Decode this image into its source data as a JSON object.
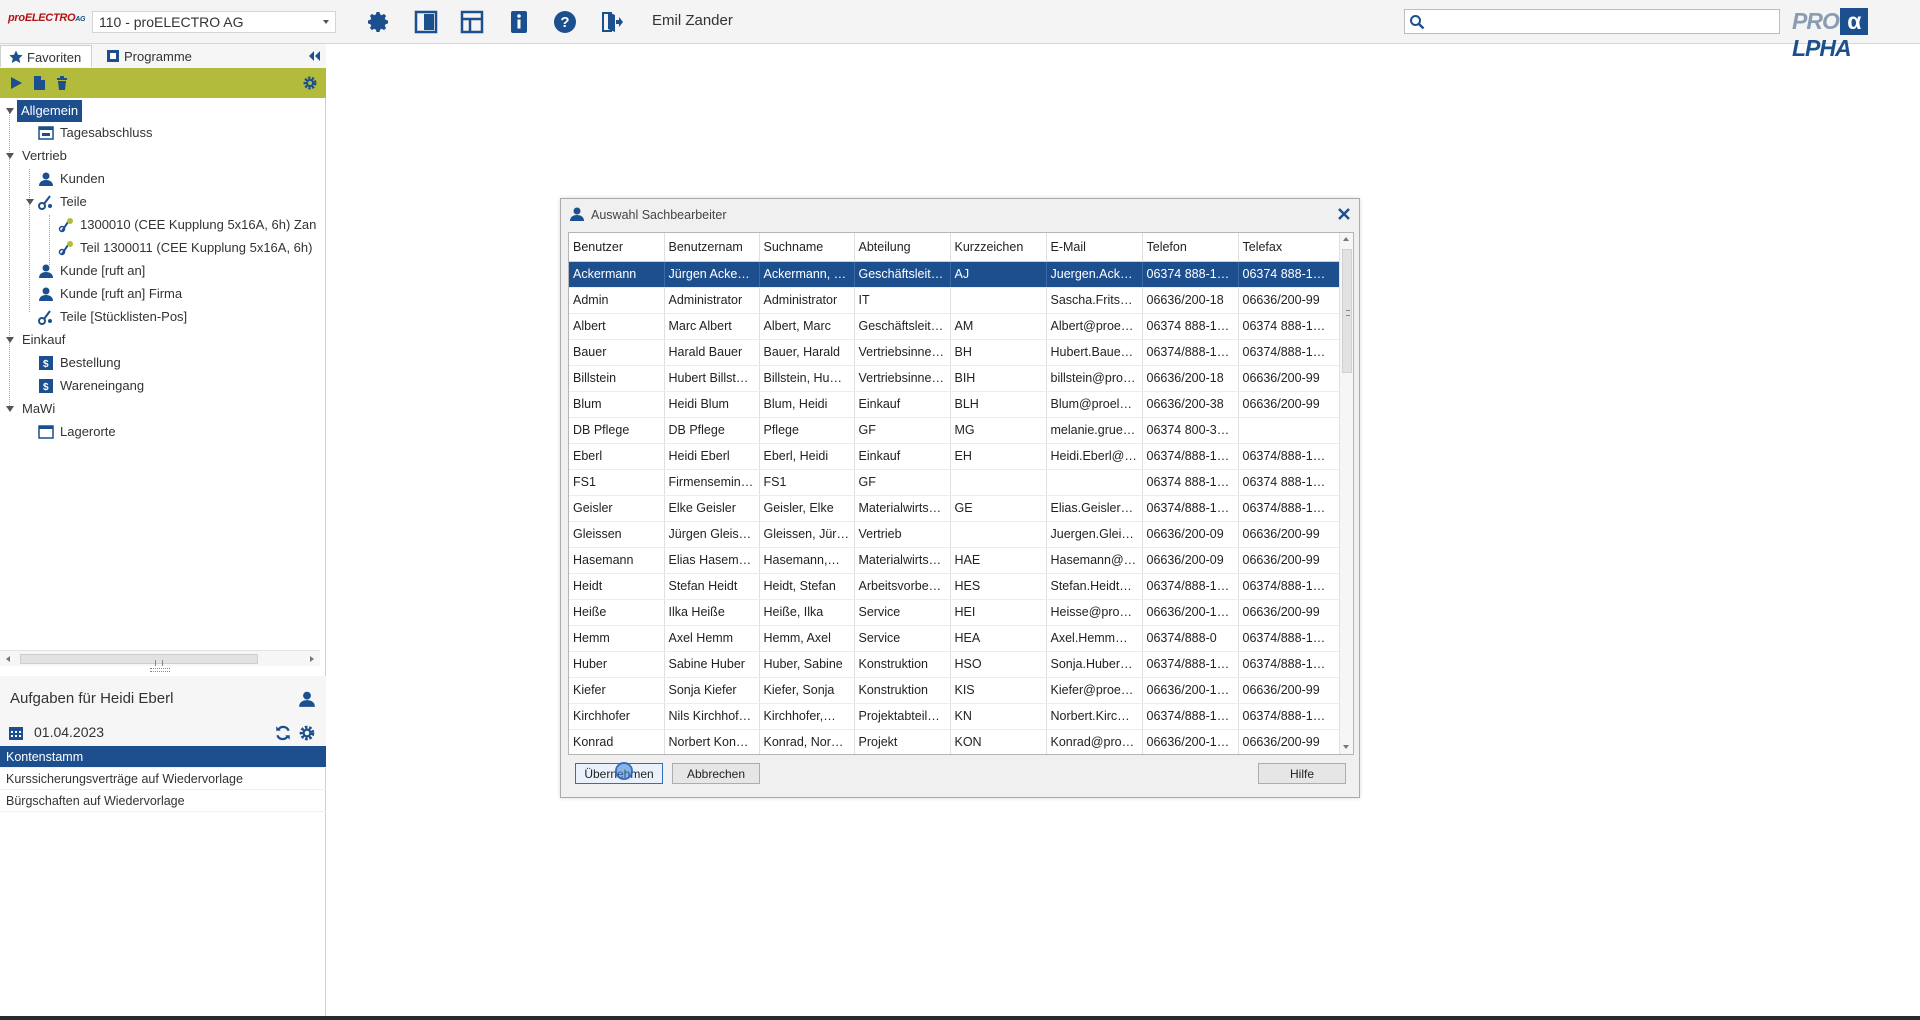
{
  "header": {
    "brand": "proELECTRO",
    "brand_suffix": "AG",
    "client": "110 - proELECTRO AG",
    "user": "Emil Zander",
    "search_value": "",
    "logo_pro": "PRO",
    "logo_alpha": "α",
    "logo_lpha": "LPHA",
    "colors": {
      "accent": "#1c4f8d",
      "toolbar_green": "#b3bb3c"
    }
  },
  "sidebar": {
    "tabs": [
      {
        "label": "Favoriten",
        "icon": "star-icon",
        "active": true
      },
      {
        "label": "Programme",
        "icon": "programs-icon",
        "active": false
      }
    ],
    "tree": {
      "allgemein": "Allgemein",
      "tagesabschluss": "Tagesabschluss",
      "vertrieb": "Vertrieb",
      "kunden": "Kunden",
      "teile": "Teile",
      "teil1": "1300010 (CEE Kupplung 5x16A, 6h) Zan",
      "teil2": "Teil 1300011 (CEE Kupplung 5x16A, 6h)",
      "kunde_ruft": "Kunde [ruft an]",
      "kunde_ruft_firma": "Kunde [ruft an] Firma",
      "teile_stueckliste": "Teile [Stücklisten-Pos]",
      "einkauf": "Einkauf",
      "bestellung": "Bestellung",
      "wareneingang": "Wareneingang",
      "mawi": "MaWi",
      "lagerorte": "Lagerorte"
    }
  },
  "tasks": {
    "title": "Aufgaben für Heidi Eberl",
    "date": "01.04.2023",
    "items": [
      "Kontenstamm",
      "Kurssicherungsverträge auf Wiedervorlage",
      "Bürgschaften auf Wiedervorlage"
    ]
  },
  "dialog": {
    "title": "Auswahl Sachbearbeiter",
    "columns": [
      "Benutzer",
      "Benutzernam",
      "Suchname",
      "Abteilung",
      "Kurzzeichen",
      "E-Mail",
      "Telefon",
      "Telefax"
    ],
    "rows": [
      [
        "Ackermann",
        "Jürgen Acke…",
        "Ackermann, …",
        "Geschäftsleit…",
        "AJ",
        "Juergen.Ack…",
        "06374 888-1…",
        "06374 888-1…"
      ],
      [
        "Admin",
        "Administrator",
        "Administrator",
        "IT",
        "",
        "Sascha.Fritsc…",
        "06636/200-18",
        "06636/200-99"
      ],
      [
        "Albert",
        "Marc Albert",
        "Albert, Marc",
        "Geschäftsleit…",
        "AM",
        "Albert@proe…",
        "06374 888-1…",
        "06374 888-1…"
      ],
      [
        "Bauer",
        "Harald Bauer",
        "Bauer, Harald",
        "Vertriebsinne…",
        "BH",
        "Hubert.Baue…",
        "06374/888-1…",
        "06374/888-1…"
      ],
      [
        "Billstein",
        "Hubert Billst…",
        "Billstein, Hu…",
        "Vertriebsinne…",
        "BIH",
        "billstein@pro…",
        "06636/200-18",
        "06636/200-99"
      ],
      [
        "Blum",
        "Heidi Blum",
        "Blum, Heidi",
        "Einkauf",
        "BLH",
        "Blum@proel…",
        "06636/200-38",
        "06636/200-99"
      ],
      [
        "DB Pflege",
        "DB Pflege",
        "Pflege",
        "GF",
        "MG",
        "melanie.grue…",
        "06374 800-3…",
        ""
      ],
      [
        "Eberl",
        "Heidi Eberl",
        "Eberl, Heidi",
        "Einkauf",
        "EH",
        "Heidi.Eberl@…",
        "06374/888-1…",
        "06374/888-1…"
      ],
      [
        "FS1",
        "Firmensemin…",
        "FS1",
        "GF",
        "",
        "",
        "06374 888-1…",
        "06374 888-1…"
      ],
      [
        "Geisler",
        "Elke Geisler",
        "Geisler, Elke",
        "Materialwirts…",
        "GE",
        "Elias.Geisler…",
        "06374/888-1…",
        "06374/888-1…"
      ],
      [
        "Gleissen",
        "Jürgen Gleis…",
        "Gleissen, Jür…",
        "Vertrieb",
        "",
        "Juergen.Glei…",
        "06636/200-09",
        "06636/200-99"
      ],
      [
        "Hasemann",
        "Elias Hasem…",
        "Hasemann,…",
        "Materialwirts…",
        "HAE",
        "Hasemann@…",
        "06636/200-09",
        "06636/200-99"
      ],
      [
        "Heidt",
        "Stefan Heidt",
        "Heidt, Stefan",
        "Arbeitsvorbe…",
        "HES",
        "Stefan.Heidt…",
        "06374/888-1…",
        "06374/888-1…"
      ],
      [
        "Heiße",
        "Ilka Heiße",
        "Heiße, Ilka",
        "Service",
        "HEI",
        "Heisse@pro…",
        "06636/200-1…",
        "06636/200-99"
      ],
      [
        "Hemm",
        "Axel Hemm",
        "Hemm, Axel",
        "Service",
        "HEA",
        "Axel.Hemm…",
        "06374/888-0",
        "06374/888-1…"
      ],
      [
        "Huber",
        "Sabine Huber",
        "Huber, Sabine",
        "Konstruktion",
        "HSO",
        "Sonja.Huber…",
        "06374/888-1…",
        "06374/888-1…"
      ],
      [
        "Kiefer",
        "Sonja Kiefer",
        "Kiefer, Sonja",
        "Konstruktion",
        "KIS",
        "Kiefer@proe…",
        "06636/200-1…",
        "06636/200-99"
      ],
      [
        "Kirchhofer",
        "Nils Kirchhof…",
        "Kirchhofer,…",
        "Projektabteil…",
        "KN",
        "Norbert.Kirc…",
        "06374/888-1…",
        "06374/888-1…"
      ],
      [
        "Konrad",
        "Norbert Kon…",
        "Konrad, Nor…",
        "Projekt",
        "KON",
        "Konrad@pro…",
        "06636/200-1…",
        "06636/200-99"
      ]
    ],
    "buttons": {
      "ok": "Übernehmen",
      "cancel": "Abbrechen",
      "help": "Hilfe"
    }
  }
}
